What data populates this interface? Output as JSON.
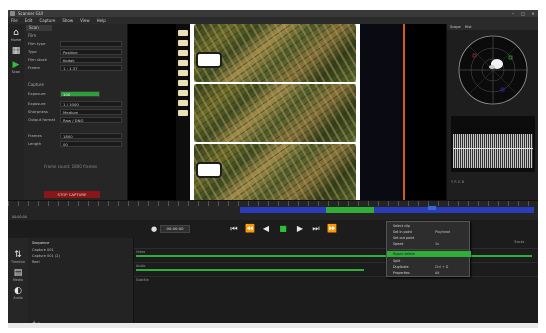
{
  "window": {
    "title": "Scanner GUI"
  },
  "menu": [
    "File",
    "Edit",
    "Capture",
    "Show",
    "View",
    "Help"
  ],
  "leftnav": [
    {
      "label": "Home",
      "icon": "home-icon",
      "glyph": "⌂",
      "color": "#e8e8e8"
    },
    {
      "label": "",
      "icon": "grid-icon",
      "glyph": "▦",
      "color": "#e8e8e8"
    },
    {
      "label": "Scan",
      "icon": "play-icon",
      "glyph": "▶",
      "color": "#2fbf3a"
    }
  ],
  "settings": {
    "tab": "Scan",
    "section_top": "Film",
    "rows_top": [
      {
        "label": "Film type",
        "value": ""
      },
      {
        "label": "Type",
        "value": "Positive"
      },
      {
        "label": "Film stock",
        "value": "Kodak"
      },
      {
        "label": "Frame",
        "value": "1 : 1.37"
      }
    ],
    "section_mid": "Capture",
    "rows_mid": [
      {
        "label": "Exposure",
        "value": "100",
        "green": true
      },
      {
        "label": "Exposure",
        "value": "1 / 1000"
      },
      {
        "label": "Sharpness",
        "value": "Medium"
      },
      {
        "label": "Output format",
        "value": "Raw / DNG"
      }
    ],
    "rows_bottom": [
      {
        "label": "Frames",
        "value": "1800"
      },
      {
        "label": "Length",
        "value": "00"
      }
    ],
    "hint": "Frame count: 1800 frames",
    "danger_button": "STOP CAPTURE"
  },
  "scopes": {
    "tabs": [
      "Scope",
      "Hist"
    ],
    "footer": "Y  R  G  B"
  },
  "timeline": {
    "sub": "00:00:00"
  },
  "transport": {
    "timecode": "00:00:00",
    "buttons": [
      {
        "name": "skip-start-button",
        "glyph": "⏮"
      },
      {
        "name": "step-back-button",
        "glyph": "⏪"
      },
      {
        "name": "reverse-play-button",
        "glyph": "◀"
      },
      {
        "name": "stop-button",
        "glyph": "■"
      },
      {
        "name": "play-button",
        "glyph": "▶"
      },
      {
        "name": "step-forward-button",
        "glyph": "⏭"
      },
      {
        "name": "skip-end-button",
        "glyph": "⏩"
      }
    ]
  },
  "bottom": {
    "nav": [
      {
        "label": "Timeline",
        "icon": "timeline-icon",
        "glyph": "⇅"
      },
      {
        "label": "Media",
        "icon": "media-icon",
        "glyph": "▤"
      },
      {
        "label": "Audio",
        "icon": "audio-icon",
        "glyph": "◐"
      }
    ],
    "tree_title": "Sequence",
    "tree": [
      "Capture 001",
      "Capture 001 (2)",
      "Reel"
    ],
    "tree_footer": "+  -",
    "tracks": [
      {
        "label": "Video",
        "fill": 0.99
      },
      {
        "label": "Audio",
        "fill": 0.57
      },
      {
        "label": "Subtitle",
        "fill": 0.0
      }
    ],
    "tracks_head": "Tracks"
  },
  "context_menu": {
    "items": [
      {
        "label": "Select clip",
        "value": ""
      },
      {
        "label": "Set in point",
        "value": "Playhead"
      },
      {
        "label": "Set out point",
        "value": ""
      },
      {
        "label": "Speed",
        "value": "1x"
      },
      {
        "label": "Ripple delete",
        "value": "",
        "highlight": true
      },
      {
        "label": "Split",
        "value": ""
      },
      {
        "label": "Duplicate",
        "value": "Ctrl + D"
      },
      {
        "label": "Properties",
        "value": "Alt"
      }
    ]
  }
}
